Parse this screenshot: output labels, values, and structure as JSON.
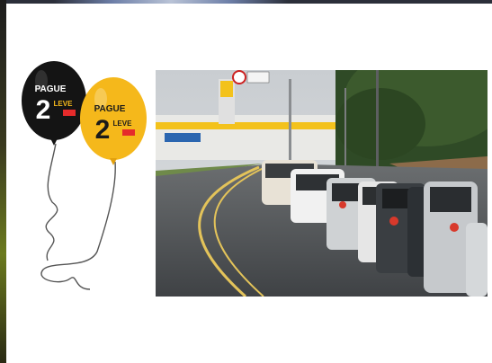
{
  "balloons": {
    "black": {
      "line1": "PAGUE",
      "number": "2",
      "line2": "LEVE",
      "color": "#141414",
      "text_color": "#ffffff"
    },
    "yellow": {
      "line1": "PAGUE",
      "number": "2",
      "line2": "LEVE",
      "color": "#f5b81b",
      "text_color": "#1a1a1a"
    },
    "accent_color": "#e52b2b"
  },
  "photo": {
    "description_icon": "fuel-queue-photo",
    "sky_color": "#cfd3d6",
    "road_color": "#4a4d50"
  }
}
